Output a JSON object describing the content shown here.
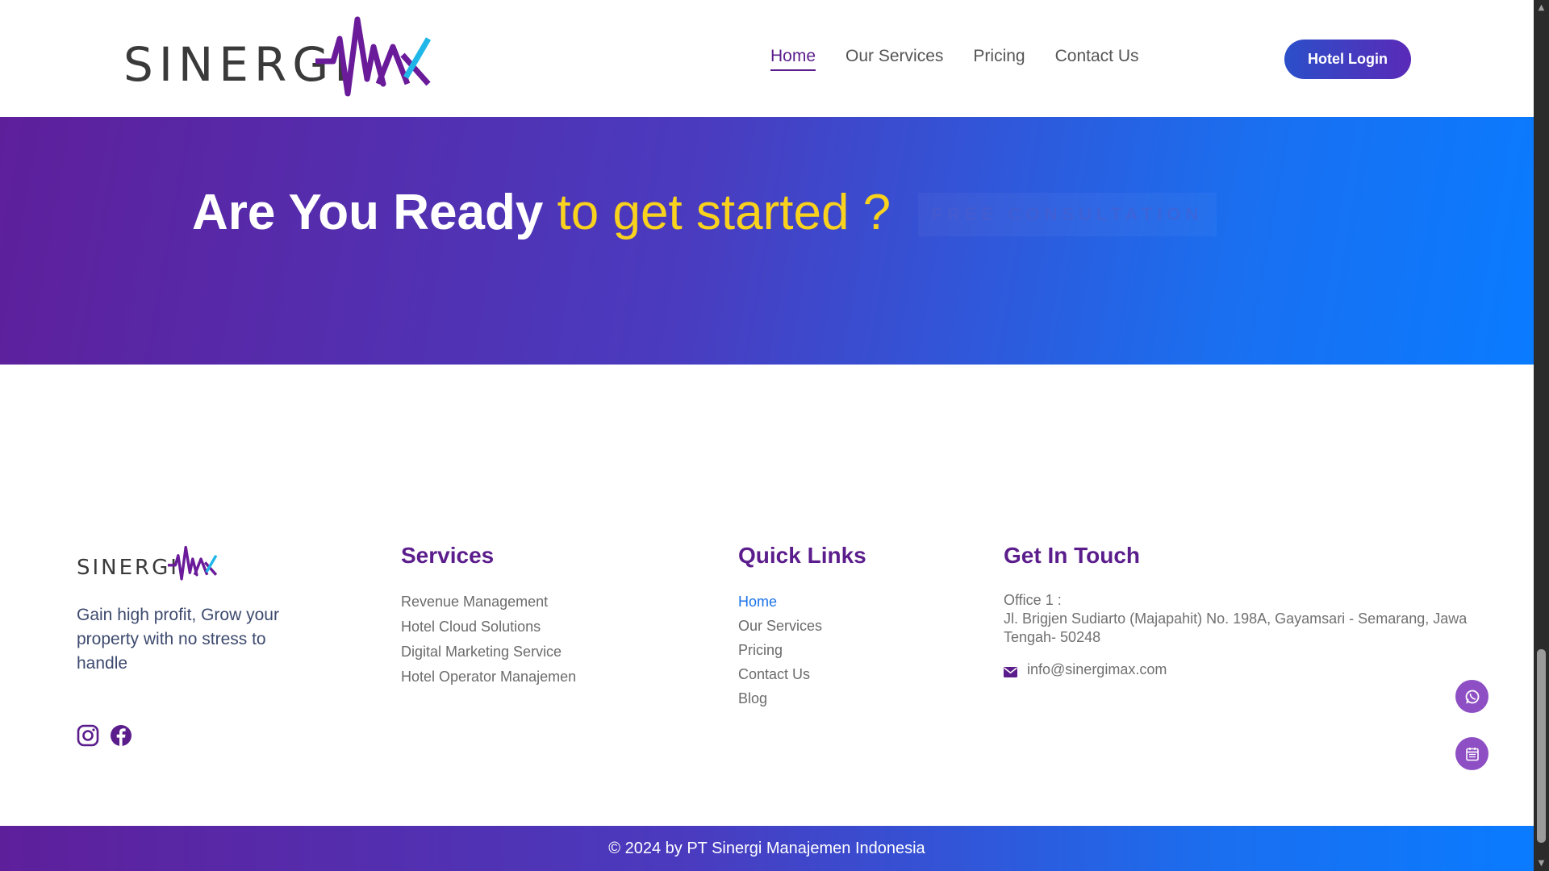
{
  "header": {
    "logo_text": "SINERGI",
    "nav": [
      {
        "label": "Home",
        "active": true
      },
      {
        "label": "Our Services",
        "active": false
      },
      {
        "label": "Pricing",
        "active": false
      },
      {
        "label": "Contact Us",
        "active": false
      }
    ],
    "login_label": "Hotel Login"
  },
  "cta": {
    "title_white": "Are You Ready",
    "title_yellow": "to get started ?",
    "button_label": "FREE CONSULTATION"
  },
  "footer": {
    "logo_text": "SINERGI",
    "tagline": "Gain high profit, Grow your property with no stress to handle",
    "social_icons": [
      "instagram-icon",
      "facebook-icon"
    ],
    "services": {
      "heading": "Services",
      "items": [
        "Revenue Management",
        "Hotel Cloud Solutions",
        "Digital Marketing Service",
        "Hotel Operator Manajemen"
      ]
    },
    "quick_links": {
      "heading": "Quick Links",
      "items": [
        "Home",
        "Our Services",
        "Pricing",
        "Contact Us",
        "Blog"
      ],
      "active_index": 0
    },
    "get_in_touch": {
      "heading": "Get In Touch",
      "office_label": "Office 1 :",
      "office_address": "Jl. Brigjen Sudiarto (Majapahit) No. 198A, Gayamsari - Semarang, Jawa Tengah- 50248",
      "email": "info@sinergimax.com"
    },
    "copyright": "© 2024 by PT Sinergi Manajemen Indonesia"
  },
  "floating_buttons": [
    "whatsapp-icon",
    "calendar-icon"
  ],
  "colors": {
    "brand_purple": "#5b1d8c",
    "accent_yellow": "#f9d21d",
    "accent_blue": "#0a7bff",
    "link_blue": "#1a73e8"
  }
}
